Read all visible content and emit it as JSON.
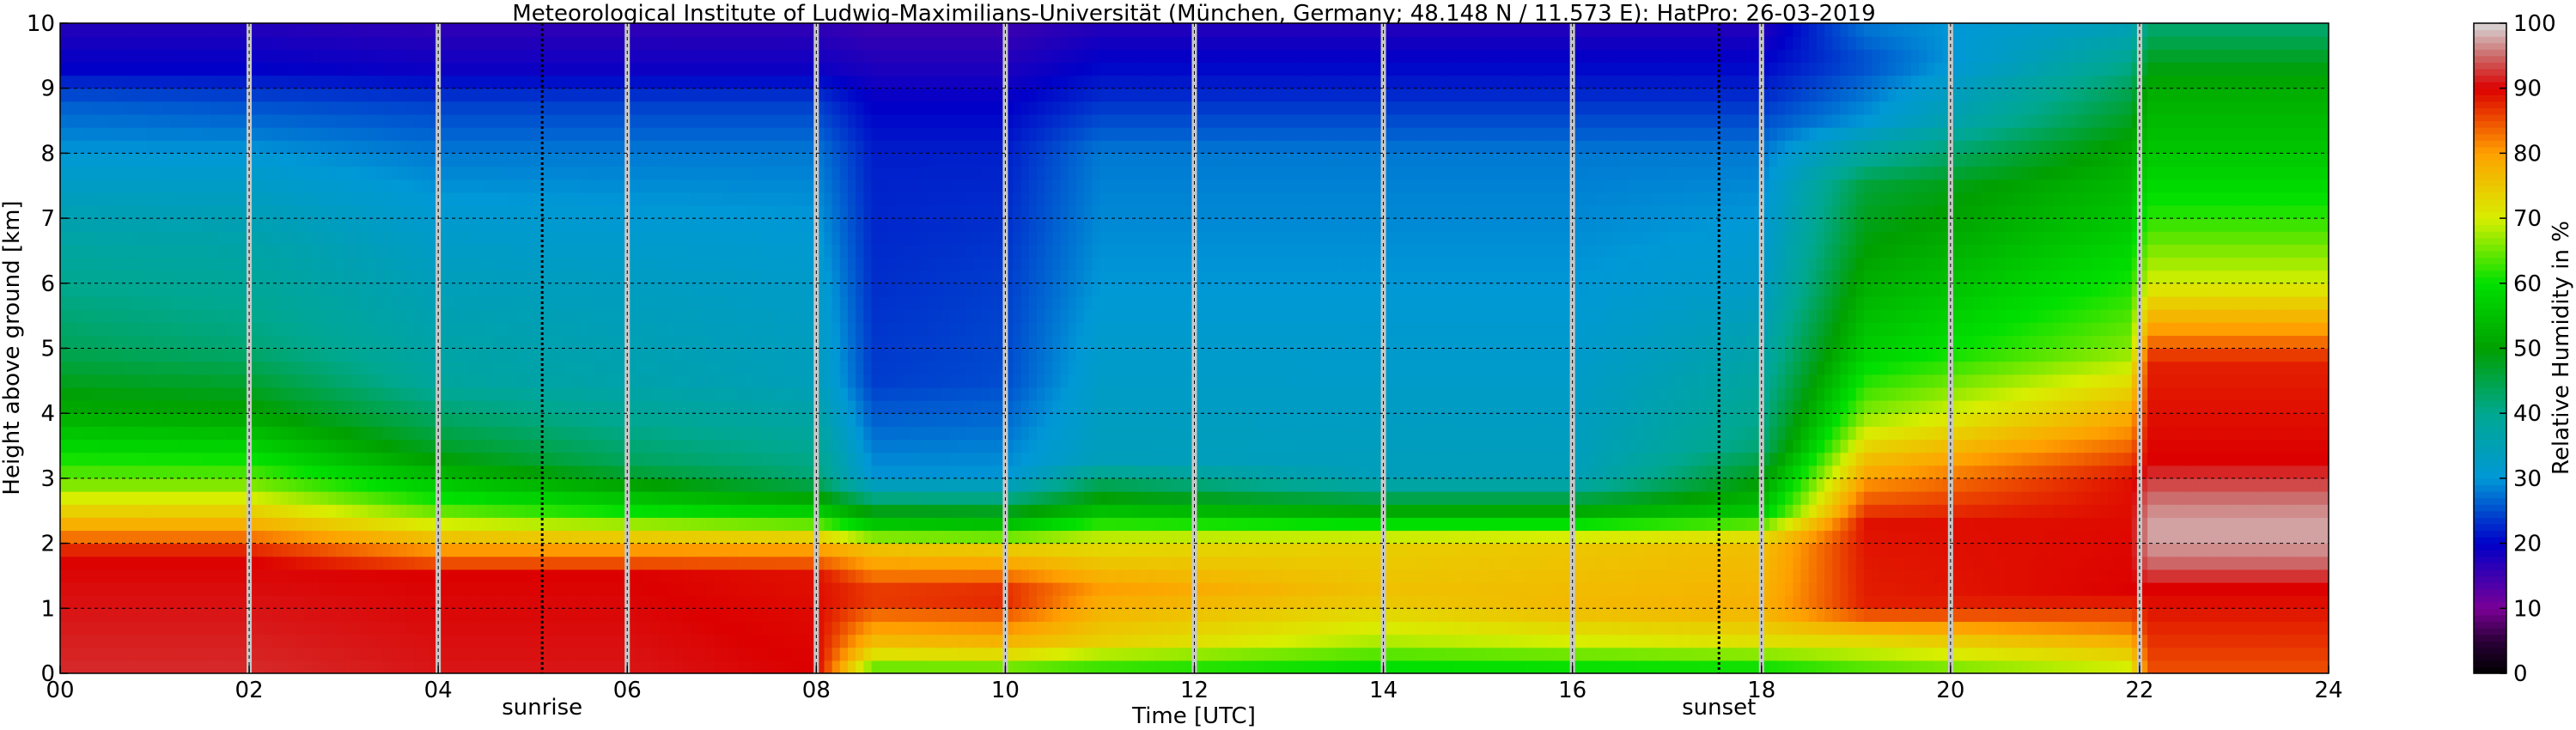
{
  "chart_data": {
    "type": "heatmap",
    "title": "Meteorological Institute of Ludwig-Maximilians-Universität (München, Germany; 48.148 N / 11.573 E):    HatPro: 26-03-2019",
    "xlabel": "Time [UTC]",
    "ylabel": "Height above ground [km]",
    "colorbar_label": "Relative Humidity in %",
    "xlim": [
      0,
      24
    ],
    "ylim": [
      0,
      10
    ],
    "clim": [
      0,
      100
    ],
    "x_ticks": [
      "00",
      "02",
      "04",
      "06",
      "08",
      "10",
      "12",
      "14",
      "16",
      "18",
      "20",
      "22",
      "24"
    ],
    "y_ticks": [
      "0",
      "1",
      "2",
      "3",
      "4",
      "5",
      "6",
      "7",
      "8",
      "9",
      "10"
    ],
    "colorbar_ticks": [
      "0",
      "10",
      "20",
      "30",
      "40",
      "50",
      "60",
      "70",
      "80",
      "90",
      "100"
    ],
    "grid": true,
    "annotations": [
      {
        "text": "sunrise",
        "time_utc": 5.1
      },
      {
        "text": "sunset",
        "time_utc": 17.55
      }
    ],
    "gap_times_utc": [
      2.0,
      4.0,
      6.0,
      8.0,
      10.0,
      12.0,
      14.0,
      16.0,
      18.0,
      20.0,
      22.0
    ],
    "colormap": [
      {
        "value": 0,
        "color": "#000000"
      },
      {
        "value": 5,
        "color": "#2a0038"
      },
      {
        "value": 10,
        "color": "#7a0096"
      },
      {
        "value": 20,
        "color": "#0000c8"
      },
      {
        "value": 30,
        "color": "#0098d6"
      },
      {
        "value": 40,
        "color": "#00a890"
      },
      {
        "value": 50,
        "color": "#00a000"
      },
      {
        "value": 60,
        "color": "#00e000"
      },
      {
        "value": 70,
        "color": "#d8ee00"
      },
      {
        "value": 80,
        "color": "#ffa000"
      },
      {
        "value": 90,
        "color": "#dc0000"
      },
      {
        "value": 95,
        "color": "#cc6a6a"
      },
      {
        "value": 100,
        "color": "#d8d8d8"
      }
    ],
    "profiles": [
      {
        "t": 0.0,
        "rh": [
          {
            "h": 0,
            "v": 92
          },
          {
            "h": 1.8,
            "v": 90
          },
          {
            "h": 2.3,
            "v": 78
          },
          {
            "h": 2.9,
            "v": 66
          },
          {
            "h": 4.0,
            "v": 52
          },
          {
            "h": 5.0,
            "v": 44
          },
          {
            "h": 6.5,
            "v": 38
          },
          {
            "h": 8.0,
            "v": 30
          },
          {
            "h": 8.8,
            "v": 26
          },
          {
            "h": 9.3,
            "v": 20
          },
          {
            "h": 10,
            "v": 17
          }
        ]
      },
      {
        "t": 2.0,
        "rh": [
          {
            "h": 0,
            "v": 92
          },
          {
            "h": 1.8,
            "v": 90
          },
          {
            "h": 2.3,
            "v": 78
          },
          {
            "h": 2.9,
            "v": 66
          },
          {
            "h": 3.9,
            "v": 52
          },
          {
            "h": 5.0,
            "v": 42
          },
          {
            "h": 6.5,
            "v": 37
          },
          {
            "h": 8.0,
            "v": 30
          },
          {
            "h": 8.8,
            "v": 25
          },
          {
            "h": 9.3,
            "v": 20
          },
          {
            "h": 10,
            "v": 17
          }
        ]
      },
      {
        "t": 4.0,
        "rh": [
          {
            "h": 0,
            "v": 91
          },
          {
            "h": 1.5,
            "v": 90
          },
          {
            "h": 2.0,
            "v": 78
          },
          {
            "h": 2.6,
            "v": 62
          },
          {
            "h": 3.4,
            "v": 48
          },
          {
            "h": 4.5,
            "v": 38
          },
          {
            "h": 6.0,
            "v": 34
          },
          {
            "h": 8.0,
            "v": 28
          },
          {
            "h": 8.8,
            "v": 24
          },
          {
            "h": 9.3,
            "v": 19
          },
          {
            "h": 10,
            "v": 16
          }
        ]
      },
      {
        "t": 6.0,
        "rh": [
          {
            "h": 0,
            "v": 91
          },
          {
            "h": 1.5,
            "v": 90
          },
          {
            "h": 2.0,
            "v": 78
          },
          {
            "h": 2.5,
            "v": 60
          },
          {
            "h": 3.2,
            "v": 44
          },
          {
            "h": 4.5,
            "v": 36
          },
          {
            "h": 6.0,
            "v": 33
          },
          {
            "h": 8.0,
            "v": 28
          },
          {
            "h": 8.8,
            "v": 24
          },
          {
            "h": 9.3,
            "v": 19
          },
          {
            "h": 10,
            "v": 16
          }
        ]
      },
      {
        "t": 8.0,
        "rh": [
          {
            "h": 0,
            "v": 90
          },
          {
            "h": 1.5,
            "v": 89
          },
          {
            "h": 2.0,
            "v": 78
          },
          {
            "h": 2.4,
            "v": 60
          },
          {
            "h": 3.0,
            "v": 42
          },
          {
            "h": 4.5,
            "v": 34
          },
          {
            "h": 6.0,
            "v": 32
          },
          {
            "h": 8.0,
            "v": 28
          },
          {
            "h": 8.8,
            "v": 24
          },
          {
            "h": 9.3,
            "v": 19
          },
          {
            "h": 10,
            "v": 16
          }
        ]
      },
      {
        "t": 8.6,
        "rh": [
          {
            "h": 0,
            "v": 62
          },
          {
            "h": 0.4,
            "v": 75
          },
          {
            "h": 1.2,
            "v": 88
          },
          {
            "h": 1.9,
            "v": 76
          },
          {
            "h": 2.3,
            "v": 56
          },
          {
            "h": 3.0,
            "v": 30
          },
          {
            "h": 4.5,
            "v": 24
          },
          {
            "h": 6.0,
            "v": 23
          },
          {
            "h": 8.0,
            "v": 22
          },
          {
            "h": 9.0,
            "v": 19
          },
          {
            "h": 10,
            "v": 15
          }
        ]
      },
      {
        "t": 10.0,
        "rh": [
          {
            "h": 0,
            "v": 62
          },
          {
            "h": 0.4,
            "v": 76
          },
          {
            "h": 1.2,
            "v": 89
          },
          {
            "h": 1.9,
            "v": 75
          },
          {
            "h": 2.3,
            "v": 55
          },
          {
            "h": 3.0,
            "v": 30
          },
          {
            "h": 4.5,
            "v": 25
          },
          {
            "h": 6.0,
            "v": 24
          },
          {
            "h": 8.0,
            "v": 22
          },
          {
            "h": 9.0,
            "v": 19
          },
          {
            "h": 10,
            "v": 15
          }
        ]
      },
      {
        "t": 11.0,
        "rh": [
          {
            "h": 0,
            "v": 60
          },
          {
            "h": 0.5,
            "v": 74
          },
          {
            "h": 1.3,
            "v": 80
          },
          {
            "h": 2.0,
            "v": 72
          },
          {
            "h": 2.5,
            "v": 55
          },
          {
            "h": 3.3,
            "v": 34
          },
          {
            "h": 6.0,
            "v": 30
          },
          {
            "h": 8.0,
            "v": 28
          },
          {
            "h": 9.0,
            "v": 22
          },
          {
            "h": 10,
            "v": 17
          }
        ]
      },
      {
        "t": 13.9,
        "rh": [
          {
            "h": 0,
            "v": 58
          },
          {
            "h": 0.5,
            "v": 68
          },
          {
            "h": 1.2,
            "v": 76
          },
          {
            "h": 2.0,
            "v": 74
          },
          {
            "h": 2.4,
            "v": 55
          },
          {
            "h": 3.0,
            "v": 34
          },
          {
            "h": 6.0,
            "v": 30
          },
          {
            "h": 8.0,
            "v": 28
          },
          {
            "h": 9.0,
            "v": 22
          },
          {
            "h": 10,
            "v": 17
          }
        ]
      },
      {
        "t": 16.0,
        "rh": [
          {
            "h": 0,
            "v": 58
          },
          {
            "h": 0.5,
            "v": 70
          },
          {
            "h": 1.0,
            "v": 77
          },
          {
            "h": 2.0,
            "v": 75
          },
          {
            "h": 2.4,
            "v": 55
          },
          {
            "h": 3.0,
            "v": 34
          },
          {
            "h": 6.0,
            "v": 30
          },
          {
            "h": 8.0,
            "v": 28
          },
          {
            "h": 9.0,
            "v": 22
          },
          {
            "h": 10,
            "v": 17
          }
        ]
      },
      {
        "t": 18.0,
        "rh": [
          {
            "h": 0,
            "v": 58
          },
          {
            "h": 0.5,
            "v": 72
          },
          {
            "h": 1.0,
            "v": 78
          },
          {
            "h": 2.0,
            "v": 76
          },
          {
            "h": 2.5,
            "v": 56
          },
          {
            "h": 3.5,
            "v": 42
          },
          {
            "h": 6.0,
            "v": 32
          },
          {
            "h": 8.0,
            "v": 28
          },
          {
            "h": 9.0,
            "v": 22
          },
          {
            "h": 10,
            "v": 17
          }
        ]
      },
      {
        "t": 19.1,
        "rh": [
          {
            "h": 0,
            "v": 62
          },
          {
            "h": 0.6,
            "v": 75
          },
          {
            "h": 1.0,
            "v": 88
          },
          {
            "h": 2.3,
            "v": 89
          },
          {
            "h": 3.3,
            "v": 76
          },
          {
            "h": 4.0,
            "v": 66
          },
          {
            "h": 5.0,
            "v": 57
          },
          {
            "h": 6.5,
            "v": 50
          },
          {
            "h": 7.5,
            "v": 46
          },
          {
            "h": 8.5,
            "v": 30
          },
          {
            "h": 9.4,
            "v": 25
          },
          {
            "h": 10,
            "v": 28
          }
        ]
      },
      {
        "t": 21.9,
        "rh": [
          {
            "h": 0,
            "v": 68
          },
          {
            "h": 0.7,
            "v": 82
          },
          {
            "h": 1.2,
            "v": 90
          },
          {
            "h": 3.0,
            "v": 89
          },
          {
            "h": 4.0,
            "v": 78
          },
          {
            "h": 5.0,
            "v": 66
          },
          {
            "h": 7.0,
            "v": 56
          },
          {
            "h": 8.0,
            "v": 52
          },
          {
            "h": 9.0,
            "v": 44
          },
          {
            "h": 10,
            "v": 34
          }
        ]
      },
      {
        "t": 22.1,
        "rh": [
          {
            "h": 0,
            "v": 85
          },
          {
            "h": 1.3,
            "v": 90
          },
          {
            "h": 1.8,
            "v": 96
          },
          {
            "h": 2.2,
            "v": 98
          },
          {
            "h": 2.6,
            "v": 96
          },
          {
            "h": 3.3,
            "v": 90
          },
          {
            "h": 4.8,
            "v": 88
          },
          {
            "h": 5.3,
            "v": 80
          },
          {
            "h": 6.0,
            "v": 70
          },
          {
            "h": 7.0,
            "v": 62
          },
          {
            "h": 8.0,
            "v": 56
          },
          {
            "h": 9.0,
            "v": 52
          },
          {
            "h": 10,
            "v": 42
          }
        ]
      },
      {
        "t": 24.0,
        "rh": [
          {
            "h": 0,
            "v": 85
          },
          {
            "h": 1.3,
            "v": 90
          },
          {
            "h": 1.8,
            "v": 96
          },
          {
            "h": 2.2,
            "v": 98
          },
          {
            "h": 2.6,
            "v": 96
          },
          {
            "h": 3.3,
            "v": 90
          },
          {
            "h": 4.8,
            "v": 88
          },
          {
            "h": 5.3,
            "v": 80
          },
          {
            "h": 6.0,
            "v": 70
          },
          {
            "h": 7.0,
            "v": 62
          },
          {
            "h": 8.0,
            "v": 56
          },
          {
            "h": 9.0,
            "v": 52
          },
          {
            "h": 10,
            "v": 42
          }
        ]
      }
    ]
  }
}
